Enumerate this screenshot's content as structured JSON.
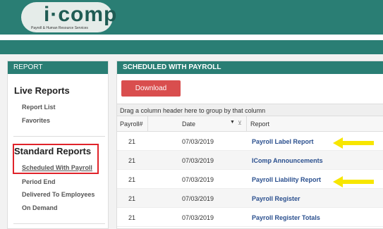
{
  "brand": {
    "name": "i·comp",
    "tagline": "Payroll & Human Resource Services"
  },
  "sidebar": {
    "header": "REPORT",
    "live_title": "Live Reports",
    "live_items": [
      "Report List",
      "Favorites"
    ],
    "standard_title": "Standard Reports",
    "standard_items": [
      "Scheduled With Payroll",
      "Period End",
      "Delivered To Employees",
      "On Demand"
    ]
  },
  "main": {
    "header": "SCHEDULED WITH PAYROLL",
    "download_label": "Download",
    "group_hint": "Drag a column header here to group by that column",
    "columns": [
      "Payroll#",
      "Date",
      "Report"
    ],
    "rows": [
      {
        "payroll": "21",
        "date": "07/03/2019",
        "report": "Payroll Label Report"
      },
      {
        "payroll": "21",
        "date": "07/03/2019",
        "report": "IComp Announcements"
      },
      {
        "payroll": "21",
        "date": "07/03/2019",
        "report": "Payroll Liability Report"
      },
      {
        "payroll": "21",
        "date": "07/03/2019",
        "report": "Payroll Register"
      },
      {
        "payroll": "21",
        "date": "07/03/2019",
        "report": "Payroll Register Totals"
      }
    ]
  },
  "colors": {
    "teal": "#2a7e74",
    "download": "#d94e4e",
    "highlight": "#e0232a",
    "arrow": "#f7e600"
  }
}
